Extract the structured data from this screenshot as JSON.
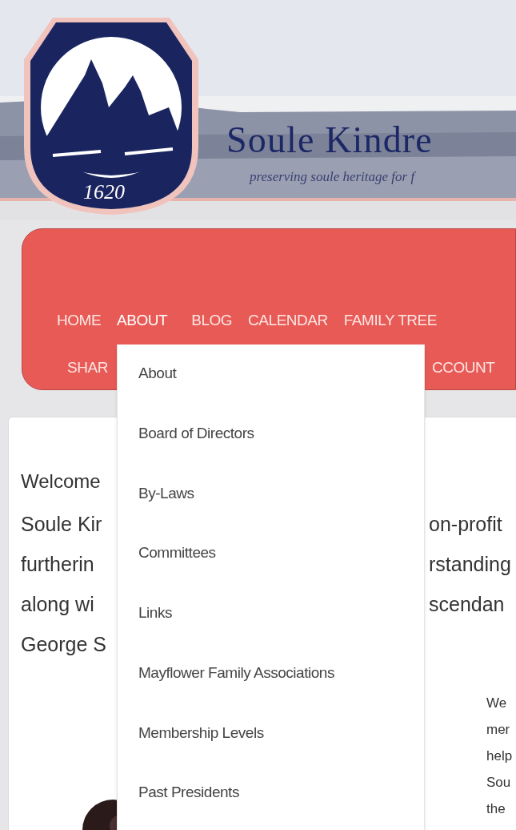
{
  "header": {
    "logo": {
      "year": "1620"
    },
    "title": "Soule Kindre",
    "tagline": "preserving soule heritage for f"
  },
  "nav": {
    "rows": [
      [
        {
          "label": "HOME",
          "selected": false
        },
        {
          "label": "ABOUT",
          "selected": true
        },
        {
          "label": "BLOG",
          "selected": false
        },
        {
          "label": "CALENDAR",
          "selected": false
        },
        {
          "label": "FAMILY TREE",
          "selected": false
        }
      ],
      [
        {
          "label": "SHAR",
          "selected": false
        },
        {
          "label": "CCOUNT",
          "selected": false
        }
      ]
    ]
  },
  "dropdown": {
    "items": [
      "About",
      "Board of Directors",
      "By-Laws",
      "Committees",
      "Links",
      "Mayflower Family Associations",
      "Membership Levels",
      "Past Presidents"
    ]
  },
  "content": {
    "heading": "Welcome",
    "lines": [
      {
        "left": "Soule Kir",
        "right": "on-profit"
      },
      {
        "left": "furtherin",
        "right": "rstanding"
      },
      {
        "left": "along wi",
        "right": "scendan"
      },
      {
        "left": "George S"
      }
    ],
    "side_lines": [
      "We",
      "mer",
      "help",
      "Sou",
      "the"
    ]
  }
}
